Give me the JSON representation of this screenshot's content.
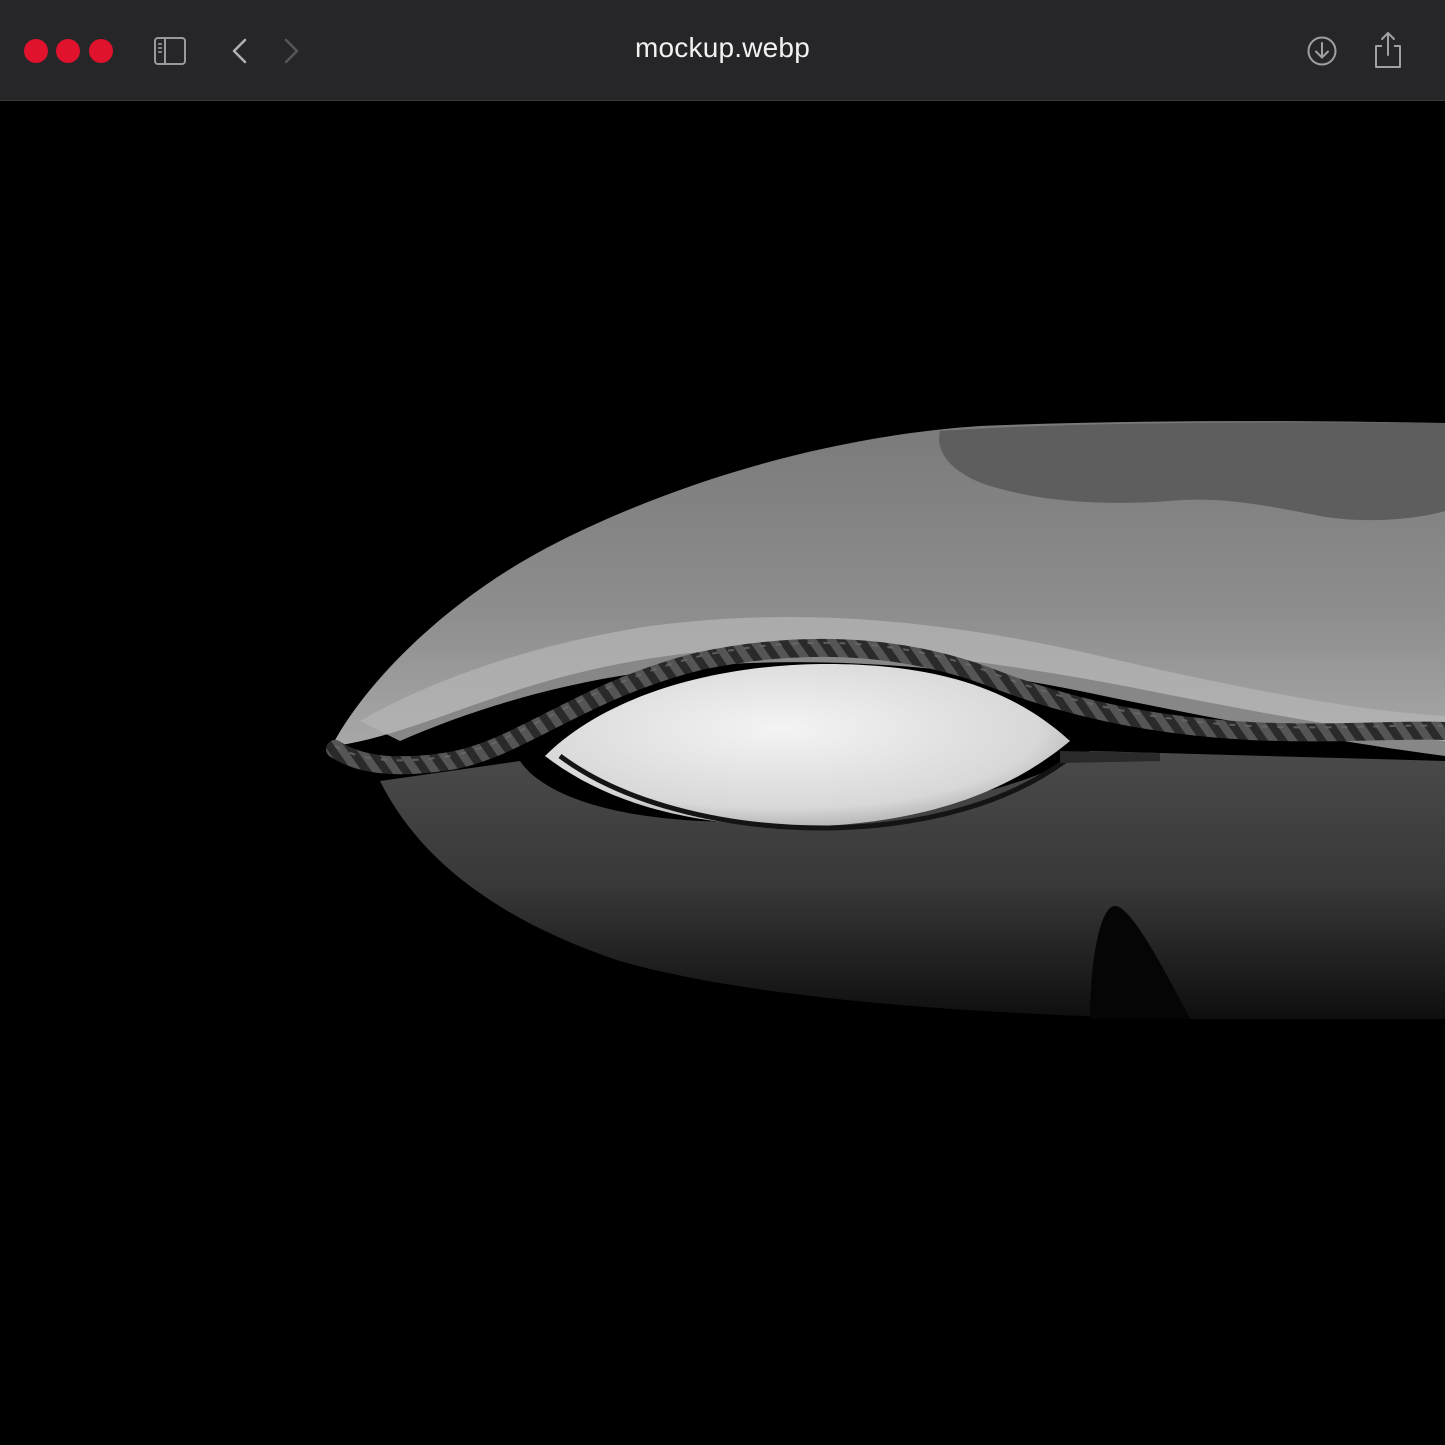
{
  "window": {
    "title": "mockup.webp",
    "traffic_light_color": "#e0122c",
    "toolbar_color": "#262628",
    "background_color": "#000000"
  },
  "toolbar": {
    "icons": [
      "sidebar-toggle-icon",
      "chevron-left-icon",
      "chevron-right-icon",
      "download-icon",
      "share-icon"
    ]
  },
  "image": {
    "subject": "pillow-mockup",
    "palette": [
      "#000000",
      "#8c8c8c",
      "#5a5a5a",
      "#dcdcdc"
    ]
  }
}
